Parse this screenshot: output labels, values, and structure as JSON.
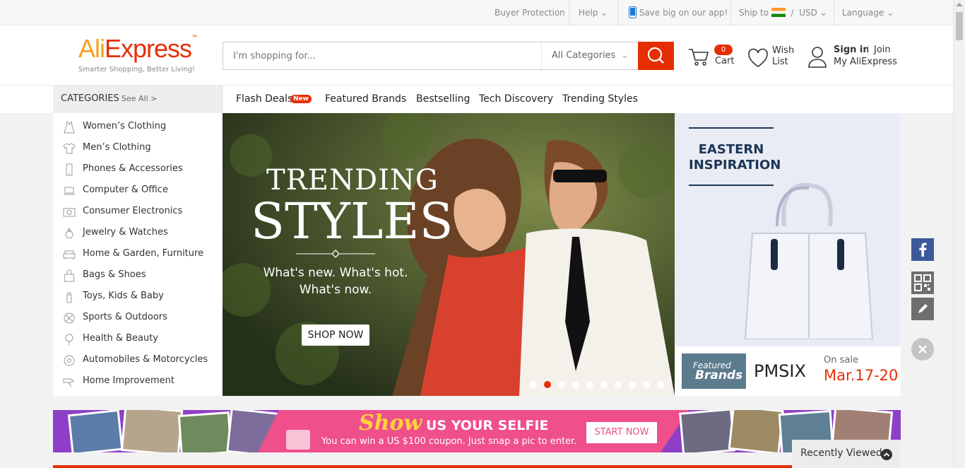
{
  "topbar": {
    "buyer_protection": "Buyer Protection",
    "help": "Help",
    "app": "Save big on our app!",
    "ship_to": "Ship to",
    "slash": "/",
    "currency": "USD",
    "language": "Language"
  },
  "header": {
    "logo_ali": "Ali",
    "logo_express": "Express",
    "logo_tm": "™",
    "tagline": "Smarter Shopping, Better Living!",
    "search_placeholder": "I'm shopping for...",
    "search_category": "All Categories",
    "cart_count": "0",
    "cart_label": "Cart",
    "wish_line1": "Wish",
    "wish_line2": "List",
    "sign_in": "Sign in",
    "join": "Join",
    "my_account": "My AliExpress"
  },
  "nav": {
    "categories_title": "CATEGORIES",
    "see_all": "See All >",
    "links": [
      "Flash Deals",
      "Featured Brands",
      "Bestselling",
      "Tech Discovery",
      "Trending Styles"
    ],
    "new_badge": "New"
  },
  "categories": [
    {
      "label": "Women’s Clothing",
      "icon": "dress-icon"
    },
    {
      "label": "Men’s Clothing",
      "icon": "shirt-icon"
    },
    {
      "label": "Phones & Accessories",
      "icon": "phone-icon"
    },
    {
      "label": "Computer & Office",
      "icon": "laptop-icon"
    },
    {
      "label": "Consumer Electronics",
      "icon": "camera-icon"
    },
    {
      "label": "Jewelry & Watches",
      "icon": "ring-icon"
    },
    {
      "label": "Home & Garden, Furniture",
      "icon": "sofa-icon"
    },
    {
      "label": "Bags & Shoes",
      "icon": "bag-icon"
    },
    {
      "label": "Toys, Kids & Baby",
      "icon": "bottle-icon"
    },
    {
      "label": "Sports & Outdoors",
      "icon": "ball-icon"
    },
    {
      "label": "Health & Beauty",
      "icon": "beauty-icon"
    },
    {
      "label": "Automobiles & Motorcycles",
      "icon": "wheel-icon"
    },
    {
      "label": "Home Improvement",
      "icon": "tool-icon"
    }
  ],
  "banner": {
    "headline1": "TRENDING",
    "headline2": "STYLES",
    "sub1": "What's new. What's hot.",
    "sub2": "What's now.",
    "cta": "SHOP NOW",
    "slide_count": 10,
    "active_slide": 2
  },
  "eastern": {
    "line1": "EASTERN",
    "line2": "INSPIRATION"
  },
  "brand_strip": {
    "featured_line1": "Featured",
    "featured_line2": "Brands",
    "brand": "PMSIX",
    "on_sale": "On sale",
    "dates": "Mar.17-20"
  },
  "selfie_banner": {
    "show": "Show",
    "title": "US YOUR SELFIE",
    "subtitle": "You can win a US $100 coupon. Just snap a pic to enter.",
    "cta": "START NOW"
  },
  "recently_viewed": "Recently Viewed",
  "colors": {
    "brand_red": "#e62e04",
    "brand_orange": "#f7a01a",
    "navy": "#1c3656",
    "facebook": "#3b5998"
  }
}
